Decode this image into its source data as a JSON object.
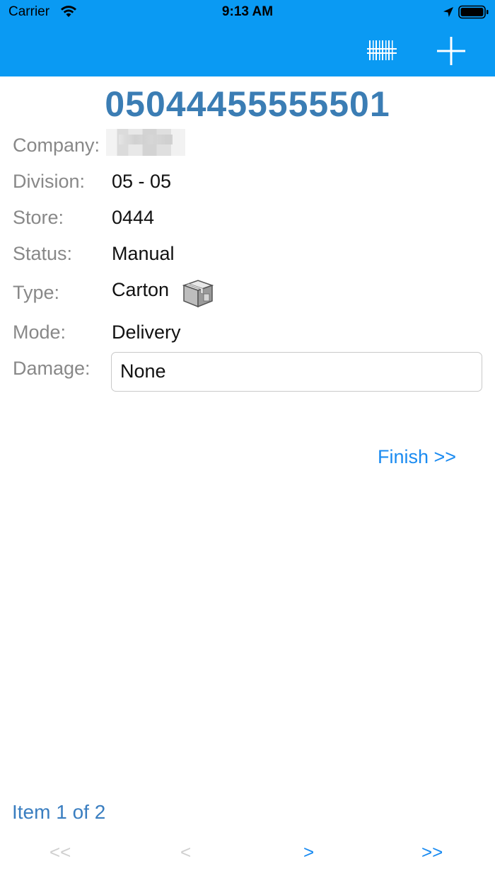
{
  "status_bar": {
    "carrier": "Carrier",
    "time": "9:13 AM"
  },
  "toolbar": {
    "barcode_icon": "barcode-icon",
    "add_icon": "plus-icon",
    "background_color": "#0A9AF3"
  },
  "title": "05044455555501",
  "fields": {
    "company_label": "Company:",
    "company_value": "",
    "division_label": "Division:",
    "division_value": "05 - 05",
    "store_label": "Store:",
    "store_value": "0444",
    "status_label": "Status:",
    "status_value": "Manual",
    "type_label": "Type:",
    "type_value": "Carton",
    "type_icon": "carton-box-icon",
    "mode_label": "Mode:",
    "mode_value": "Delivery",
    "damage_label": "Damage:",
    "damage_value": "None"
  },
  "actions": {
    "finish_label": "Finish >>"
  },
  "pagination": {
    "item_text": "Item 1 of 2",
    "first_label": "<<",
    "prev_label": "<",
    "next_label": ">",
    "last_label": ">>"
  },
  "colors": {
    "accent": "#1A8BF1",
    "title": "#3B7DB4",
    "disabled": "#CFCFCF"
  }
}
